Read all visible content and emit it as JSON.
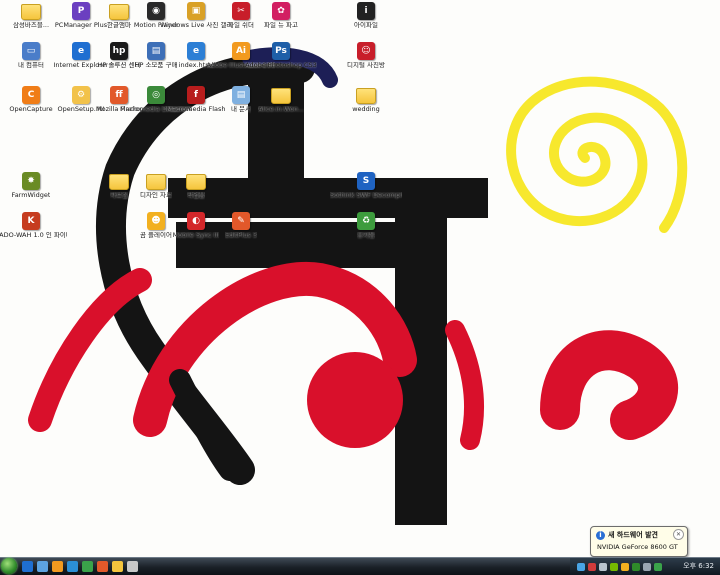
{
  "desktop_icons": [
    {
      "label": "삼성바즈블...",
      "name": "desktop-icon-samsung-folder",
      "kind": "folder",
      "color": "#f5c53d",
      "glyph": ""
    },
    {
      "label": "PCManager Plus",
      "name": "desktop-icon-pcmanager",
      "kind": "app",
      "color": "#6b3fc0",
      "glyph": "P"
    },
    {
      "label": "한글앰마",
      "name": "desktop-icon-hangul-folder",
      "kind": "folder",
      "color": "#f5c53d",
      "glyph": ""
    },
    {
      "label": "Motion Player",
      "name": "desktop-icon-motion-player",
      "kind": "app",
      "color": "#2a2a2a",
      "glyph": "◉"
    },
    {
      "label": "Windows Live 사진 갤러리",
      "name": "desktop-icon-windows-live-gallery",
      "kind": "app",
      "color": "#d9a126",
      "glyph": "▣"
    },
    {
      "label": "파일 쉬더",
      "name": "desktop-icon-file-shredder",
      "kind": "app",
      "color": "#c81e2a",
      "glyph": "✂"
    },
    {
      "label": "파일 뉴 파고",
      "name": "desktop-icon-file-new",
      "kind": "app",
      "color": "#d21f62",
      "glyph": "✿"
    },
    {
      "label": "아이파일",
      "name": "desktop-icon-ifile",
      "kind": "app",
      "color": "#222222",
      "glyph": "i"
    },
    {
      "label": "내 컴퓨터",
      "name": "desktop-icon-my-computer",
      "kind": "app",
      "color": "#4a7dc9",
      "glyph": "▭"
    },
    {
      "label": "Internet Explorer",
      "name": "desktop-icon-internet-explorer",
      "kind": "app",
      "color": "#1f6fd1",
      "glyph": "e"
    },
    {
      "label": "HP 솔루션 센터",
      "name": "desktop-icon-hp-solution-center",
      "kind": "app",
      "color": "#1a1a1a",
      "glyph": "hp"
    },
    {
      "label": "HP 소모품 구매",
      "name": "desktop-icon-hp-supplies",
      "kind": "app",
      "color": "#3d6fb7",
      "glyph": "▤"
    },
    {
      "label": "index.html",
      "name": "desktop-icon-index-html",
      "kind": "app",
      "color": "#2c7fd5",
      "glyph": "e"
    },
    {
      "label": "Adobe Illustrator CS3",
      "name": "desktop-icon-illustrator",
      "kind": "app",
      "color": "#f29a1f",
      "glyph": "Ai"
    },
    {
      "label": "Adobe Photoshop CS3",
      "name": "desktop-icon-photoshop",
      "kind": "app",
      "color": "#1e5fa8",
      "glyph": "Ps"
    },
    {
      "label": "디지털 사진방",
      "name": "desktop-icon-digital-photo",
      "kind": "app",
      "color": "#c81e2a",
      "glyph": "☺"
    },
    {
      "label": "OpenCapture",
      "name": "desktop-icon-opencapture",
      "kind": "app",
      "color": "#f07d17",
      "glyph": "C"
    },
    {
      "label": "OpenSetup.INI",
      "name": "desktop-icon-opensetup-ini",
      "kind": "app",
      "color": "#f2c24a",
      "glyph": "⚙"
    },
    {
      "label": "Mozilla Firefox",
      "name": "desktop-icon-firefox",
      "kind": "app",
      "color": "#e2592a",
      "glyph": "ff"
    },
    {
      "label": "Macromedia Dreamweaver",
      "name": "desktop-icon-dreamweaver",
      "kind": "app",
      "color": "#3b8a3a",
      "glyph": "◎"
    },
    {
      "label": "Macromedia Flash",
      "name": "desktop-icon-flash",
      "kind": "app",
      "color": "#b81d1d",
      "glyph": "f"
    },
    {
      "label": "내 문서",
      "name": "desktop-icon-my-documents",
      "kind": "app",
      "color": "#7fb0e0",
      "glyph": "▤"
    },
    {
      "label": "Alice.in.Won...",
      "name": "desktop-icon-alice-folder",
      "kind": "folder",
      "color": "#f5c53d",
      "glyph": ""
    },
    {
      "label": "wedding",
      "name": "desktop-icon-wedding-folder",
      "kind": "folder",
      "color": "#f5c53d",
      "glyph": ""
    },
    {
      "label": "FarmWidget",
      "name": "desktop-icon-farmwidget",
      "kind": "app",
      "color": "#6a8b24",
      "glyph": "✸"
    },
    {
      "label": "자료실",
      "name": "desktop-icon-archive-folder",
      "kind": "folder",
      "color": "#f5c53d",
      "glyph": ""
    },
    {
      "label": "디자인 자료",
      "name": "desktop-icon-design-folder",
      "kind": "folder",
      "color": "#f5c53d",
      "glyph": ""
    },
    {
      "label": "작업물",
      "name": "desktop-icon-work-folder",
      "kind": "folder",
      "color": "#f5c53d",
      "glyph": ""
    },
    {
      "label": "Sothink SWF Decompiler",
      "name": "desktop-icon-sothink-swf",
      "kind": "app",
      "color": "#1f63c2",
      "glyph": "S"
    },
    {
      "label": "KADO-WAH 1.0 인 파이터",
      "name": "desktop-icon-kado-wah",
      "kind": "app",
      "color": "#c63c1f",
      "glyph": "K"
    },
    {
      "label": "곰 플레이어",
      "name": "desktop-icon-gom-player",
      "kind": "app",
      "color": "#f2b01f",
      "glyph": "☻"
    },
    {
      "label": "Mobile Sync III",
      "name": "desktop-icon-mobile-sync",
      "kind": "app",
      "color": "#d3272a",
      "glyph": "◐"
    },
    {
      "label": "EditPlus 3",
      "name": "desktop-icon-editplus",
      "kind": "app",
      "color": "#e2582a",
      "glyph": "✎"
    },
    {
      "label": "휴지통",
      "name": "desktop-icon-recycle-bin",
      "kind": "app",
      "color": "#3d9c3d",
      "glyph": "♻"
    }
  ],
  "balloon": {
    "title": "새 하드웨어 발견",
    "body": "NVIDIA GeForce 8600 GT",
    "info_glyph": "i",
    "close_glyph": "✕"
  },
  "taskbar": {
    "quicklaunch": [
      {
        "name": "quicklaunch-ie-icon",
        "color": "#1f6fd1"
      },
      {
        "name": "quicklaunch-desktop-icon",
        "color": "#5da3e0"
      },
      {
        "name": "quicklaunch-media-icon",
        "color": "#f29a1f"
      },
      {
        "name": "quicklaunch-flip-icon",
        "color": "#2b8fd6"
      },
      {
        "name": "quicklaunch-messenger-icon",
        "color": "#3aa34a"
      },
      {
        "name": "quicklaunch-firefox-icon",
        "color": "#e2592a"
      },
      {
        "name": "quicklaunch-folder-icon",
        "color": "#f5c53d"
      },
      {
        "name": "quicklaunch-music-icon",
        "color": "#c8c8c8"
      }
    ],
    "tray_icons": [
      {
        "name": "tray-network-icon",
        "color": "#49a5e6"
      },
      {
        "name": "tray-shield-icon",
        "color": "#d13b3b"
      },
      {
        "name": "tray-volume-icon",
        "color": "#b9c4ce"
      },
      {
        "name": "tray-nvidia-icon",
        "color": "#76b900"
      },
      {
        "name": "tray-update-icon",
        "color": "#f2b01f"
      },
      {
        "name": "tray-antivirus-icon",
        "color": "#2f8a2a"
      },
      {
        "name": "tray-hardware-icon",
        "color": "#9aa6b2"
      },
      {
        "name": "tray-messenger-icon",
        "color": "#3aa34a"
      }
    ],
    "clock": "오후 6:32"
  },
  "wallpaper": {
    "colors": {
      "black": "#141414",
      "red": "#d9102b",
      "yellow": "#f7e82d",
      "navy": "#1d1f56"
    }
  }
}
